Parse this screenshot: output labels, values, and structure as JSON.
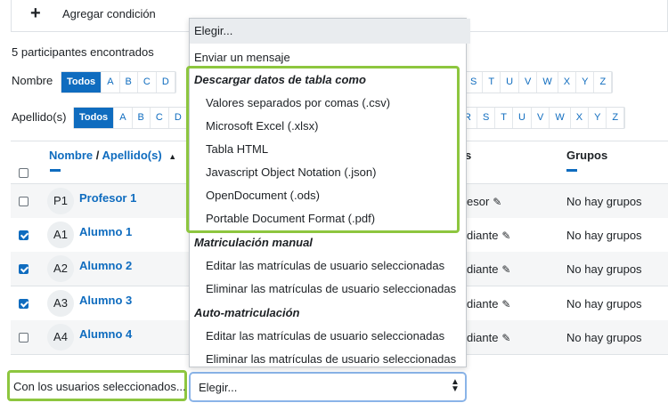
{
  "filter": {
    "add_condition_label": "Agregar condición"
  },
  "participants_count": "5 participantes encontrados",
  "name_filter": {
    "label": "Nombre",
    "left_letters": [
      "Todos",
      "A",
      "B",
      "C",
      "D"
    ],
    "right_letters": [
      "S",
      "T",
      "U",
      "V",
      "W",
      "X",
      "Y",
      "Z"
    ]
  },
  "surname_filter": {
    "label": "Apellido(s)",
    "left_letters": [
      "Todos",
      "A",
      "B",
      "C",
      "D"
    ],
    "right_letters": [
      "R",
      "S",
      "T",
      "U",
      "V",
      "W",
      "X",
      "Y",
      "Z"
    ]
  },
  "table": {
    "col_name": "Nombre",
    "col_sep": " / ",
    "col_surname": "Apellido(s)",
    "col_sort_arrow": "▲",
    "col_roles_partial": "s",
    "col_groups": "Grupos",
    "rows": [
      {
        "checked": false,
        "initials": "P1",
        "name": "Profesor 1",
        "role": "esor",
        "groups": "No hay grupos"
      },
      {
        "checked": true,
        "initials": "A1",
        "name": "Alumno 1",
        "role": "diante",
        "groups": "No hay grupos"
      },
      {
        "checked": true,
        "initials": "A2",
        "name": "Alumno 2",
        "role": "diante",
        "groups": "No hay grupos"
      },
      {
        "checked": true,
        "initials": "A3",
        "name": "Alumno 3",
        "role": "diante",
        "groups": "No hay grupos"
      },
      {
        "checked": false,
        "initials": "A4",
        "name": "Alumno 4",
        "role": "diante",
        "groups": "No hay grupos"
      }
    ]
  },
  "dropdown": {
    "choose": "Elegir...",
    "send_message": "Enviar un mensaje",
    "download_group": "Descargar datos de tabla como",
    "download_options": [
      "Valores separados por comas (.csv)",
      "Microsoft Excel (.xlsx)",
      "Tabla HTML",
      "Javascript Object Notation (.json)",
      "OpenDocument (.ods)",
      "Portable Document Format (.pdf)"
    ],
    "manual_group": "Matriculación manual",
    "manual_options": [
      "Editar las matrículas de usuario seleccionadas",
      "Eliminar las matrículas de usuario seleccionadas"
    ],
    "self_group": "Auto-matriculación",
    "self_options": [
      "Editar las matrículas de usuario seleccionadas",
      "Eliminar las matrículas de usuario seleccionadas"
    ]
  },
  "bulk_action": {
    "label": "Con los usuarios seleccionados...",
    "select_value": "Elegir..."
  },
  "colors": {
    "accent": "#0f6cbf",
    "highlight": "#8dc63f"
  }
}
